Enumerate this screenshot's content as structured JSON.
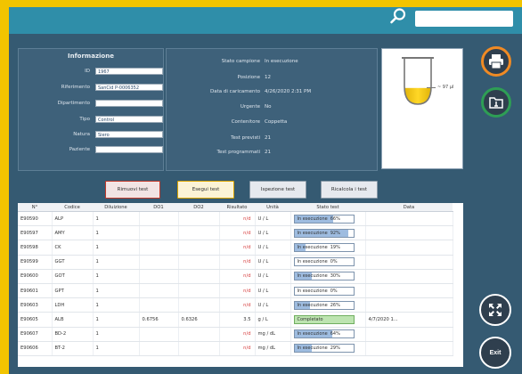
{
  "colors": {
    "topbar": "#2f8ea9",
    "app_bg": "#355a72",
    "accent_printer": "#f08a24",
    "accent_folder": "#2e9e55"
  },
  "search": {
    "placeholder": ""
  },
  "info": {
    "title": "Informazione",
    "fields": [
      {
        "label": "ID",
        "value": "1967"
      },
      {
        "label": "Riferimento",
        "value": "SanCid P-0006352"
      },
      {
        "label": "Dipartimento",
        "value": ""
      },
      {
        "label": "Tipo",
        "value": "Control"
      },
      {
        "label": "Natura",
        "value": "Siero"
      },
      {
        "label": "Paziente",
        "value": ""
      }
    ]
  },
  "sample": {
    "rows": [
      {
        "label": "Stato campione",
        "value": "In esecuzione"
      },
      {
        "label": "Posizione",
        "value": "12"
      },
      {
        "label": "Data di caricamento",
        "value": "4/26/2020 2:31 PM"
      },
      {
        "label": "Urgente",
        "value": "No"
      },
      {
        "label": "Contenitore",
        "value": "Coppetta"
      },
      {
        "label": "Test previsti",
        "value": "21"
      },
      {
        "label": "Test programmati",
        "value": "21"
      }
    ],
    "volume_label": "~ 97 µl",
    "liquid_level": 0.35
  },
  "actions": {
    "remove": "Rimuovi test",
    "execute": "Esegui test",
    "inspect": "Ispezione test",
    "recalc": "Ricalcola i test"
  },
  "table": {
    "headers": [
      "N°",
      "Codice",
      "Diluizione",
      "DO1",
      "DO2",
      "Risultato",
      "Unità",
      "Stato test",
      "Data"
    ],
    "rows": [
      {
        "n": "E90590",
        "code": "ALP",
        "dil": "1",
        "do1": "",
        "do2": "",
        "res": "n/d",
        "unit": "U / L",
        "status": "In esecuzione",
        "pct": "66%",
        "p": 0.66,
        "date": "",
        "done": false
      },
      {
        "n": "E90597",
        "code": "AMY",
        "dil": "1",
        "do1": "",
        "do2": "",
        "res": "n/d",
        "unit": "U / L",
        "status": "In esecuzione",
        "pct": "92%",
        "p": 0.92,
        "date": "",
        "done": false
      },
      {
        "n": "E90598",
        "code": "CK",
        "dil": "1",
        "do1": "",
        "do2": "",
        "res": "n/d",
        "unit": "U / L",
        "status": "In esecuzione",
        "pct": "19%",
        "p": 0.19,
        "date": "",
        "done": false
      },
      {
        "n": "E90599",
        "code": "GGT",
        "dil": "1",
        "do1": "",
        "do2": "",
        "res": "n/d",
        "unit": "U / L",
        "status": "In esecuzione",
        "pct": "0%",
        "p": 0.0,
        "date": "",
        "done": false
      },
      {
        "n": "E90600",
        "code": "GOT",
        "dil": "1",
        "do1": "",
        "do2": "",
        "res": "n/d",
        "unit": "U / L",
        "status": "In esecuzione",
        "pct": "30%",
        "p": 0.3,
        "date": "",
        "done": false
      },
      {
        "n": "E90601",
        "code": "GPT",
        "dil": "1",
        "do1": "",
        "do2": "",
        "res": "n/d",
        "unit": "U / L",
        "status": "In esecuzione",
        "pct": "0%",
        "p": 0.0,
        "date": "",
        "done": false
      },
      {
        "n": "E90603",
        "code": "LDH",
        "dil": "1",
        "do1": "",
        "do2": "",
        "res": "n/d",
        "unit": "U / L",
        "status": "In esecuzione",
        "pct": "26%",
        "p": 0.26,
        "date": "",
        "done": false
      },
      {
        "n": "E90605",
        "code": "ALB",
        "dil": "1",
        "do1": "0.6756",
        "do2": "0.6326",
        "res": "3.5",
        "unit": "g / L",
        "status": "Completato",
        "pct": "",
        "p": 1.0,
        "date": "4/7/2020 1...",
        "done": true
      },
      {
        "n": "E90607",
        "code": "BD-2",
        "dil": "1",
        "do1": "",
        "do2": "",
        "res": "n/d",
        "unit": "mg / dL",
        "status": "In esecuzione",
        "pct": "64%",
        "p": 0.64,
        "date": "",
        "done": false
      },
      {
        "n": "E90606",
        "code": "BT-2",
        "dil": "1",
        "do1": "",
        "do2": "",
        "res": "n/d",
        "unit": "mg / dL",
        "status": "In esecuzione",
        "pct": "29%",
        "p": 0.29,
        "date": "",
        "done": false
      }
    ]
  },
  "side": {
    "exit": "Exit"
  }
}
